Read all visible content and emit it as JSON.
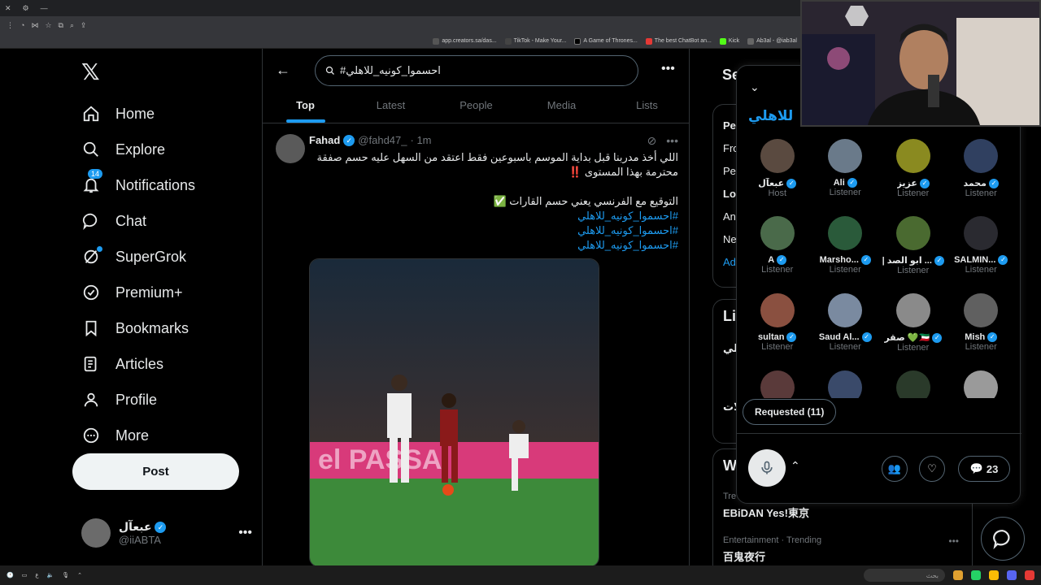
{
  "browser": {
    "bookmarks": [
      "app.creators.sa/das...",
      "TikTok - Make Your...",
      "A Game of Thrones...",
      "The best ChatBot an...",
      "Kick",
      "Ab3al - @iab3al"
    ]
  },
  "sidebar": {
    "logo": "𝕏",
    "items": [
      {
        "label": "Home"
      },
      {
        "label": "Explore"
      },
      {
        "label": "Notifications",
        "badge": "14"
      },
      {
        "label": "Chat"
      },
      {
        "label": "SuperGrok"
      },
      {
        "label": "Premium+"
      },
      {
        "label": "Bookmarks"
      },
      {
        "label": "Articles"
      },
      {
        "label": "Profile"
      },
      {
        "label": "More"
      }
    ],
    "post_label": "Post",
    "account": {
      "name": "عبعآل",
      "handle": "@iiABTA"
    }
  },
  "main": {
    "search_value": "#احسموا_كونيه_للاهلي",
    "tabs": [
      "Top",
      "Latest",
      "People",
      "Media",
      "Lists"
    ],
    "tweet": {
      "name": "Fahad",
      "handle": "@fahd47_",
      "time": "· 1m",
      "line1": "اللي أخذ مدربنا قبل بداية الموسم باسبوعين فقط اعتقد من السهل عليه حسم صفقة محترمة بهذا المستوى ‼️",
      "line2": "التوقيع مع الفرنسي يعني حسم القارات ✅",
      "hashtags": [
        "#احسموا_كونيه_للاهلي",
        "#احسموا_كونيه_للاهلي",
        "#احسموا_كونيه_للاهلي"
      ],
      "media_text": "el   PASSA"
    }
  },
  "right": {
    "search_partial": "Se",
    "card1_lines": [
      "Pe",
      "Fro",
      "Pe",
      "Lo",
      "An",
      "Ne",
      "Ad"
    ],
    "card2_lines": [
      "Li",
      "لي",
      "لات"
    ],
    "what_partial": "W",
    "trend_partial": "Tre",
    "trends": [
      {
        "name": "EBiDAN Yes!東京"
      },
      {
        "category": "Entertainment · Trending",
        "name": "百鬼夜行"
      }
    ]
  },
  "space": {
    "title": "للاهلي",
    "people": [
      {
        "name": "عبعآل",
        "role": "Host"
      },
      {
        "name": "Ali",
        "role": "Listener"
      },
      {
        "name": "عزيز",
        "role": "Listener"
      },
      {
        "name": "محمد",
        "role": "Listener"
      },
      {
        "name": "A",
        "role": "Listener"
      },
      {
        "name": "Marsho...",
        "role": "Listener"
      },
      {
        "name": "| ابو الصد ...",
        "role": "Listener"
      },
      {
        "name": "SALMIN...",
        "role": "Listener"
      },
      {
        "name": "sultan",
        "role": "Listener"
      },
      {
        "name": "Saud Al...",
        "role": "Listener"
      },
      {
        "name": "صقر 💚🇰🇼",
        "role": "Listener"
      },
      {
        "name": "Mish",
        "role": "Listener"
      }
    ],
    "requested_label": "Requested (11)",
    "comment_count": "23"
  },
  "taskbar": {
    "left_text": "ع",
    "search_text": "بحث"
  },
  "colors": {
    "accent": "#1d9bf0",
    "background": "#000000",
    "border": "#2f3336"
  }
}
